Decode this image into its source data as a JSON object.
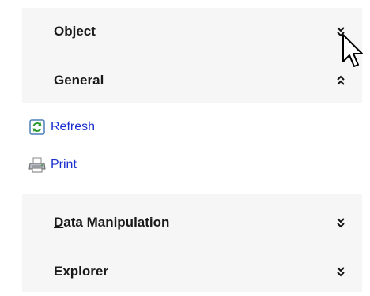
{
  "sections": [
    {
      "title": "Object",
      "state": "collapsed",
      "chevron_icon": "chevron-double-down-icon"
    },
    {
      "title": "General",
      "state": "expanded",
      "chevron_icon": "chevron-double-up-icon"
    },
    {
      "title_accel": "D",
      "title_rest": "ata Manipulation",
      "state": "collapsed",
      "chevron_icon": "chevron-double-down-icon"
    },
    {
      "title": "Explorer",
      "state": "collapsed",
      "chevron_icon": "chevron-double-down-icon"
    }
  ],
  "general_items": [
    {
      "label": "Refresh",
      "icon": "refresh-icon"
    },
    {
      "label": "Print",
      "icon": "printer-icon"
    }
  ],
  "colors": {
    "link_text": "#1a2fcf",
    "header_text": "#1a1a1a",
    "panel_bg": "#f6f6f6",
    "content_bg": "#ffffff"
  },
  "cursor_icon": "mouse-pointer-icon"
}
